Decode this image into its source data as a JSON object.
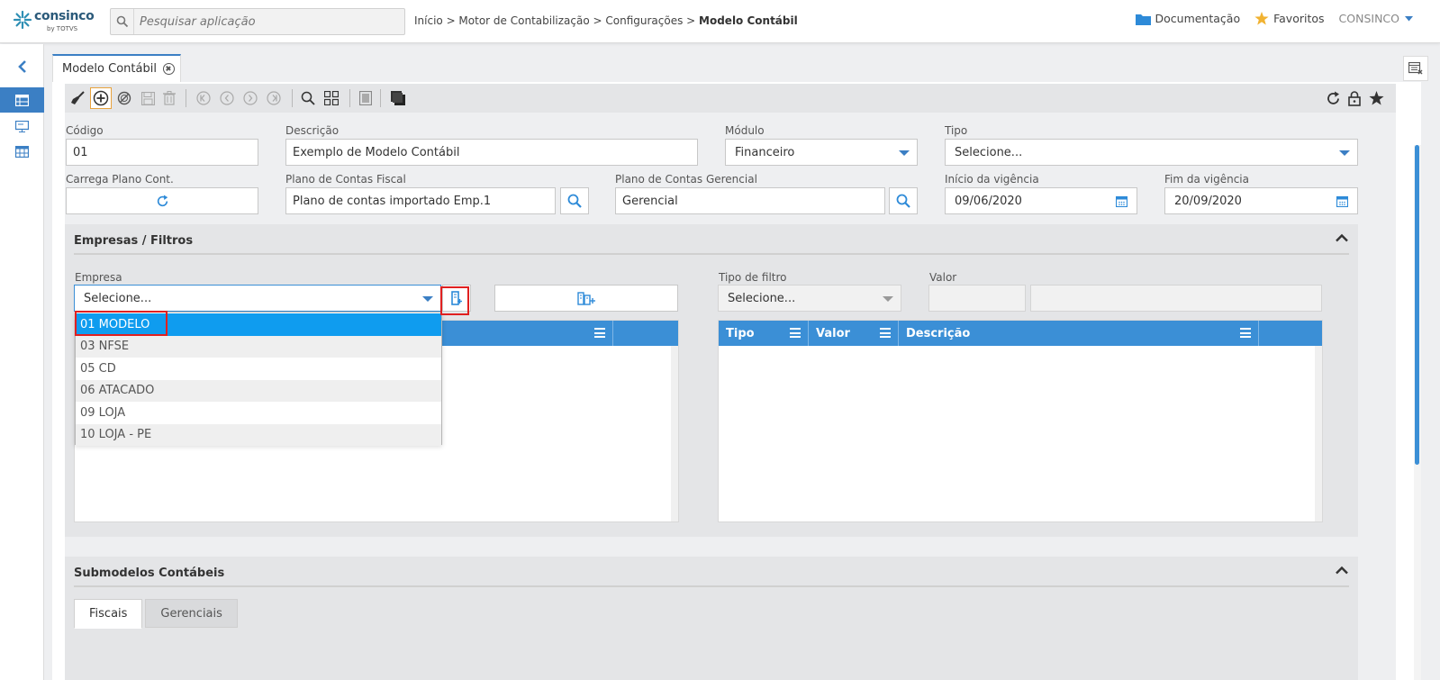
{
  "app": {
    "logo_text": "consinco",
    "logo_sub": "by TOTVS",
    "search_placeholder": "Pesquisar aplicação",
    "breadcrumb_path": "Início > Motor de Contabilização > Configurações > ",
    "breadcrumb_current": "Modelo Contábil",
    "links": {
      "docs": "Documentação",
      "favorites": "Favoritos"
    },
    "user": "CONSINCO",
    "accent_color": "#3b7fc4"
  },
  "tab": {
    "title": "Modelo Contábil"
  },
  "form": {
    "codigo": {
      "label": "Código",
      "value": "01"
    },
    "descricao": {
      "label": "Descrição",
      "value": "Exemplo de Modelo Contábil"
    },
    "modulo": {
      "label": "Módulo",
      "value": "Financeiro"
    },
    "tipo": {
      "label": "Tipo",
      "value": "Selecione..."
    },
    "carrega_plano": {
      "label": "Carrega Plano Cont."
    },
    "plano_fiscal": {
      "label": "Plano de Contas Fiscal",
      "value": "Plano de contas importado Emp.1"
    },
    "plano_gerencial": {
      "label": "Plano de Contas Gerencial",
      "value": "Gerencial"
    },
    "inicio_vigencia": {
      "label": "Início da vigência",
      "value": "09/06/2020"
    },
    "fim_vigencia": {
      "label": "Fim da vigência",
      "value": "20/09/2020"
    }
  },
  "empresas_section": {
    "title": "Empresas / Filtros",
    "empresa": {
      "label": "Empresa",
      "value": "Selecione..."
    },
    "tipo_filtro": {
      "label": "Tipo de filtro",
      "value": "Selecione..."
    },
    "valor": {
      "label": "Valor"
    },
    "filter_grid_headers": [
      "Tipo",
      "Valor",
      "Descrição"
    ],
    "dropdown_options": [
      {
        "label": "01 MODELO",
        "selected": true
      },
      {
        "label": "03 NFSE",
        "selected": false
      },
      {
        "label": "05 CD",
        "selected": false
      },
      {
        "label": "06 ATACADO",
        "selected": false
      },
      {
        "label": "09 LOJA",
        "selected": false
      },
      {
        "label": "10 LOJA - PE",
        "selected": false
      }
    ]
  },
  "submodelos_section": {
    "title": "Submodelos Contábeis",
    "tabs": [
      {
        "label": "Fiscais",
        "active": true
      },
      {
        "label": "Gerenciais",
        "active": false
      }
    ]
  }
}
